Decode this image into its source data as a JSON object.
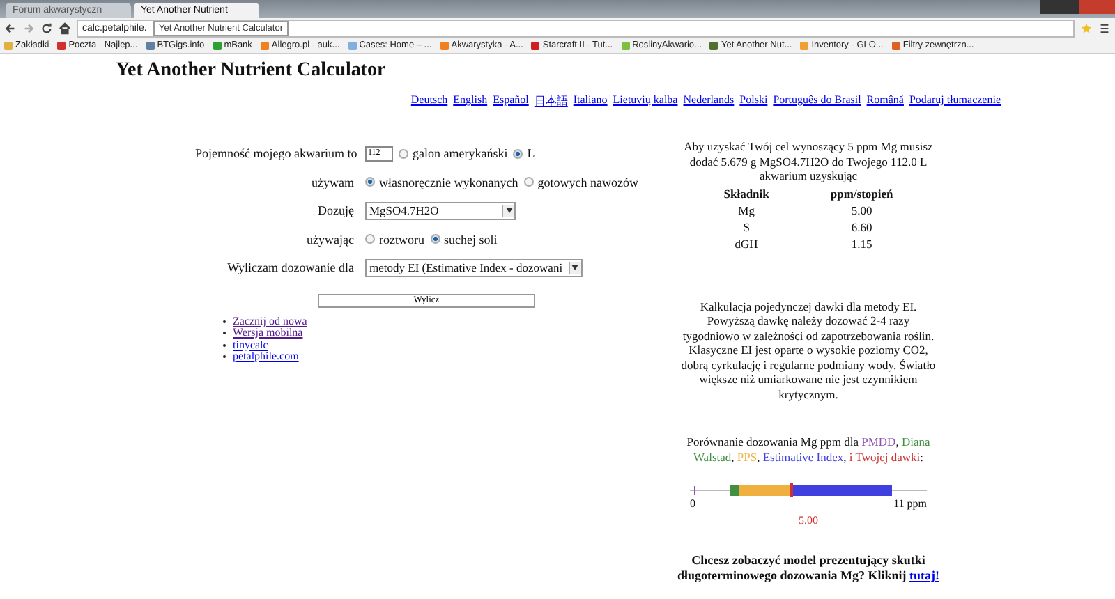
{
  "browser": {
    "tabs": [
      {
        "title": "Forum akwarystyczn",
        "selected": false
      },
      {
        "title": "Yet Another Nutrient",
        "selected": true
      }
    ],
    "address": "calc.petalphile.",
    "tooltip": "Yet Another Nutrient Calculator",
    "bookmarks": [
      {
        "label": "Zakładki",
        "color": "#e0b040"
      },
      {
        "label": "Poczta - Najlep...",
        "color": "#d03030"
      },
      {
        "label": "BTGigs.info",
        "color": "#6080a0"
      },
      {
        "label": "mBank",
        "color": "#30a030"
      },
      {
        "label": "Allegro.pl - auk...",
        "color": "#f08020"
      },
      {
        "label": "Cases: Home – ...",
        "color": "#80b0e0"
      },
      {
        "label": "Akwarystyka - A...",
        "color": "#f08020"
      },
      {
        "label": "Starcraft II - Tut...",
        "color": "#d02020"
      },
      {
        "label": "RoslinyAkwario...",
        "color": "#80c040"
      },
      {
        "label": "Yet Another Nut...",
        "color": "#507030"
      },
      {
        "label": "Inventory - GLO...",
        "color": "#f0a030"
      },
      {
        "label": "Filtry zewnętrzn...",
        "color": "#e06020"
      }
    ]
  },
  "page": {
    "title": "Yet Another Nutrient Calculator",
    "languages": [
      "Deutsch",
      "English",
      "Español",
      "日本語",
      "Italiano",
      "Lietuvių kalba",
      "Nederlands",
      "Polski",
      "Português do Brasil",
      "Română",
      "Podaruj tłumaczenie"
    ],
    "form": [
      {
        "kind": "volume",
        "label": "Pojemność mojego akwarium to",
        "value": "112",
        "options": [
          {
            "label": "galon amerykański",
            "selected": false
          },
          {
            "label": "L",
            "selected": true
          }
        ]
      },
      {
        "kind": "radio",
        "label": "używam",
        "options": [
          {
            "label": "własnoręcznie wykonanych",
            "selected": true
          },
          {
            "label": "gotowych nawozów",
            "selected": false
          }
        ]
      },
      {
        "kind": "select",
        "label": "Dozuję",
        "value": "MgSO4.7H2O"
      },
      {
        "kind": "radio",
        "label": "używając",
        "options": [
          {
            "label": "roztworu",
            "selected": false
          },
          {
            "label": "suchej soli",
            "selected": true
          }
        ]
      },
      {
        "kind": "select",
        "label": "Wyliczam dozowanie dla",
        "value": "metody EI (Estimative Index - dozowani"
      }
    ],
    "button": "Wylicz",
    "links": [
      {
        "label": "Zacznij od nowa",
        "visited": true
      },
      {
        "label": "Wersja mobilna",
        "visited": true
      },
      {
        "label": "tinycalc",
        "visited": false
      },
      {
        "label": "petalphile.com",
        "visited": false
      }
    ],
    "result": "Aby uzyskać Twój cel wynoszący 5 ppm Mg musisz dodać 5.679 g MgSO4.7H2O do Twojego 112.0 L akwarium uzyskując",
    "table": {
      "columns": [
        "Składnik",
        "ppm/stopień"
      ],
      "rows": [
        [
          "Mg",
          "5.00"
        ],
        [
          "S",
          "6.60"
        ],
        [
          "dGH",
          "1.15"
        ]
      ]
    },
    "note": "Kalkulacja pojedynczej dawki dla metody EI. Powyższą dawkę należy dozować 2-4 razy tygodniowo w zależności od zapotrzebowania roślin. Klasyczne EI jest oparte o wysokie poziomy CO2, dobrą cyrkulację i regularne podmiany wody. Światło większe niż umiarkowane nie jest czynnikiem krytycznym.",
    "comparison": {
      "intro": "Porównanie dozowania Mg ppm dla",
      "items": [
        {
          "label": "PMDD",
          "suffix": ",",
          "color": "#9050b0"
        },
        {
          "label": "Diana Walstad",
          "suffix": ",",
          "color": "#409040"
        },
        {
          "label": "PPS",
          "suffix": ",",
          "color": "#f0b040"
        },
        {
          "label": "Estimative Index",
          "suffix": ",",
          "color": "#4040e0"
        },
        {
          "label": "i Twojej dawki",
          "suffix": ":",
          "color": "#d03030"
        }
      ]
    },
    "scale": {
      "min": "0",
      "max": "11 ppm",
      "dose": "5.00"
    },
    "cta": "Chcesz zobaczyć model prezentujący skutki długoterminowego dozowania Mg? Kliknij",
    "cta_link": "tutaj!"
  }
}
